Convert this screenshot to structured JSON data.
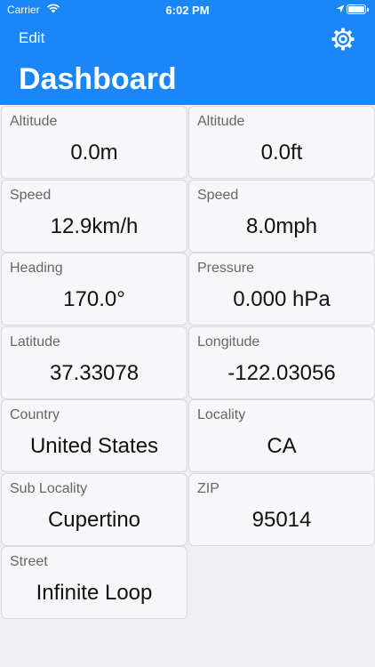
{
  "status_bar": {
    "carrier": "Carrier",
    "time": "6:02 PM",
    "icons": [
      "wifi-icon",
      "location-arrow-icon",
      "battery-icon"
    ]
  },
  "nav": {
    "edit_label": "Edit",
    "settings_icon": "gear-icon",
    "title": "Dashboard"
  },
  "colors": {
    "header_bg": "#1a86f8",
    "page_bg": "#efeff4",
    "cell_bg": "#f7f7f9"
  },
  "cells": [
    {
      "label": "Altitude",
      "value": "0.0m"
    },
    {
      "label": "Altitude",
      "value": "0.0ft"
    },
    {
      "label": "Speed",
      "value": "12.9km/h"
    },
    {
      "label": "Speed",
      "value": "8.0mph"
    },
    {
      "label": "Heading",
      "value": "170.0°"
    },
    {
      "label": "Pressure",
      "value": "0.000 hPa"
    },
    {
      "label": "Latitude",
      "value": "37.33078"
    },
    {
      "label": "Longitude",
      "value": "-122.03056"
    },
    {
      "label": "Country",
      "value": "United States"
    },
    {
      "label": "Locality",
      "value": "CA"
    },
    {
      "label": "Sub Locality",
      "value": "Cupertino"
    },
    {
      "label": "ZIP",
      "value": "95014"
    },
    {
      "label": "Street",
      "value": "Infinite Loop"
    }
  ]
}
